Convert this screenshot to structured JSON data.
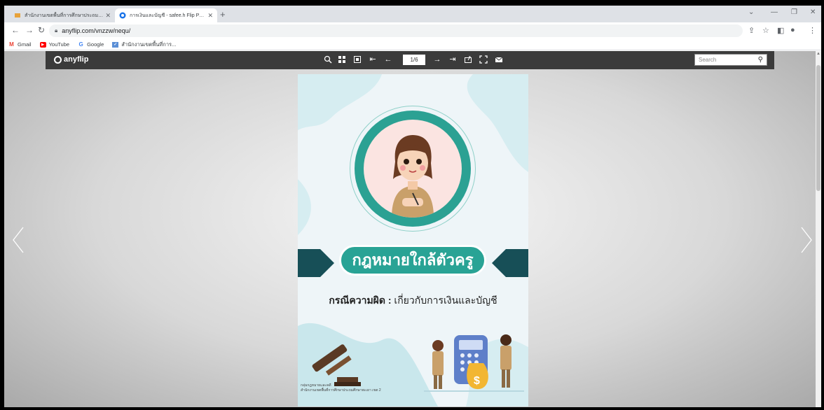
{
  "browser": {
    "tabs": [
      {
        "title": "สำนักงานเขตพื้นที่การศึกษาประถมศึกษา",
        "active": false
      },
      {
        "title": "การเงินและบัญชี - safee.h Flip PDF",
        "active": true
      }
    ],
    "new_tab": "+",
    "url": "anyflip.com/vnzzw/nequ/",
    "bookmarks": [
      {
        "label": "Gmail",
        "icon": "gmail-icon"
      },
      {
        "label": "YouTube",
        "icon": "youtube-icon"
      },
      {
        "label": "Google",
        "icon": "google-icon"
      },
      {
        "label": "สำนักงานเขตพื้นที่การ...",
        "icon": "site-icon"
      }
    ]
  },
  "flipbook": {
    "logo": "anyflip",
    "page_indicator": "1/6",
    "search_placeholder": "Search",
    "toolbar_icons": [
      "zoom-in-icon",
      "thumbnails-icon",
      "single-page-icon",
      "first-page-icon",
      "previous-page-icon",
      "next-page-icon",
      "last-page-icon",
      "share-icon",
      "fullscreen-icon",
      "email-icon"
    ]
  },
  "cover": {
    "title": "กฎหมายใกล้ตัวครู",
    "subtitle_bold": "กรณีความผิด :",
    "subtitle_rest": " เกี่ยวกับการเงินและบัญชี",
    "footer_line1": "กลุ่มกฎหมายและคดี",
    "footer_line2": "สำนักงานเขตพื้นที่การศึกษาประถมศึกษาพะเยา เขต 2"
  },
  "colors": {
    "teal": "#29a395",
    "dark_teal": "#174f57",
    "flip_toolbar": "#3b3b3b"
  }
}
